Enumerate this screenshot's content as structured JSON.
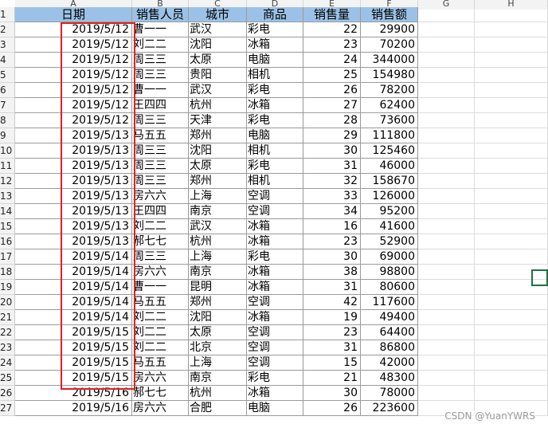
{
  "columns": [
    "A",
    "B",
    "C",
    "D",
    "E",
    "F",
    "G",
    "H"
  ],
  "header": [
    "日期",
    "销售人员",
    "城市",
    "商品",
    "销售量",
    "销售额"
  ],
  "rows": [
    [
      "2",
      "2019/5/12",
      "曹一一",
      "武汉",
      "彩电",
      "22",
      "29900"
    ],
    [
      "3",
      "2019/5/12",
      "刘二二",
      "沈阳",
      "冰箱",
      "23",
      "70200"
    ],
    [
      "4",
      "2019/5/12",
      "周三三",
      "太原",
      "电脑",
      "24",
      "344000"
    ],
    [
      "5",
      "2019/5/12",
      "周三三",
      "贵阳",
      "相机",
      "25",
      "154980"
    ],
    [
      "6",
      "2019/5/12",
      "曹一一",
      "武汉",
      "彩电",
      "26",
      "78200"
    ],
    [
      "7",
      "2019/5/12",
      "王四四",
      "杭州",
      "冰箱",
      "27",
      "62400"
    ],
    [
      "8",
      "2019/5/12",
      "周三三",
      "天津",
      "彩电",
      "28",
      "73600"
    ],
    [
      "9",
      "2019/5/13",
      "马五五",
      "郑州",
      "电脑",
      "29",
      "111800"
    ],
    [
      "10",
      "2019/5/13",
      "周三三",
      "沈阳",
      "相机",
      "30",
      "125460"
    ],
    [
      "11",
      "2019/5/13",
      "周三三",
      "太原",
      "彩电",
      "31",
      "46000"
    ],
    [
      "12",
      "2019/5/13",
      "周三三",
      "郑州",
      "相机",
      "32",
      "158670"
    ],
    [
      "13",
      "2019/5/13",
      "房六六",
      "上海",
      "空调",
      "33",
      "126000"
    ],
    [
      "14",
      "2019/5/13",
      "王四四",
      "南京",
      "空调",
      "34",
      "95200"
    ],
    [
      "15",
      "2019/5/13",
      "刘二二",
      "武汉",
      "冰箱",
      "16",
      "41600"
    ],
    [
      "16",
      "2019/5/13",
      "郝七七",
      "杭州",
      "冰箱",
      "23",
      "52900"
    ],
    [
      "17",
      "2019/5/14",
      "周三三",
      "上海",
      "彩电",
      "30",
      "69000"
    ],
    [
      "18",
      "2019/5/14",
      "房六六",
      "南京",
      "冰箱",
      "38",
      "98800"
    ],
    [
      "19",
      "2019/5/14",
      "曹一一",
      "昆明",
      "冰箱",
      "31",
      "80600"
    ],
    [
      "20",
      "2019/5/14",
      "马五五",
      "郑州",
      "空调",
      "42",
      "117600"
    ],
    [
      "21",
      "2019/5/14",
      "刘二二",
      "沈阳",
      "冰箱",
      "19",
      "49400"
    ],
    [
      "22",
      "2019/5/15",
      "刘二二",
      "太原",
      "空调",
      "23",
      "64400"
    ],
    [
      "23",
      "2019/5/15",
      "刘二二",
      "北京",
      "空调",
      "31",
      "86800"
    ],
    [
      "24",
      "2019/5/15",
      "马五五",
      "上海",
      "空调",
      "15",
      "42000"
    ],
    [
      "25",
      "2019/5/15",
      "房六六",
      "南京",
      "彩电",
      "21",
      "48300"
    ],
    [
      "26",
      "2019/5/16",
      "郝七七",
      "杭州",
      "冰箱",
      "30",
      "78000"
    ],
    [
      "27",
      "2019/5/16",
      "房六六",
      "合肥",
      "电脑",
      "26",
      "223600"
    ]
  ],
  "watermark": "CSDN @YuanYWRS"
}
